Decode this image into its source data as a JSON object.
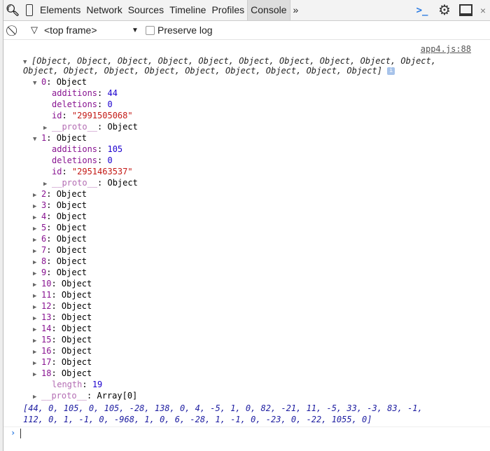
{
  "tabs": [
    "Elements",
    "Network",
    "Sources",
    "Timeline",
    "Profiles",
    "Console"
  ],
  "more": "»",
  "toolbar": {
    "frame": "<top frame>",
    "preserve_log": "Preserve log",
    "preserve_checked": false
  },
  "console": {
    "source_link": "app4.js:88",
    "summary_line1": "[Object, Object, Object, Object, Object, Object, Object, Object, Object, Object,",
    "summary_line2": "Object, Object, Object, Object, Object, Object, Object, Object, Object]",
    "expanded": [
      {
        "index": "0",
        "type": "Object",
        "additions": "44",
        "deletions": "0",
        "id": "\"2991505068\""
      },
      {
        "index": "1",
        "type": "Object",
        "additions": "105",
        "deletions": "0",
        "id": "\"2951463537\""
      }
    ],
    "labels": {
      "additions": "additions",
      "deletions": "deletions",
      "id": "id",
      "proto": "__proto__",
      "object": "Object",
      "length": "length",
      "array_proto": "Array[0]"
    },
    "collapsed": [
      "2",
      "3",
      "4",
      "5",
      "6",
      "7",
      "8",
      "9",
      "10",
      "11",
      "12",
      "13",
      "14",
      "15",
      "16",
      "17",
      "18"
    ],
    "length": "19",
    "array_line1": "[44, 0, 105, 0, 105, -28, 138, 0, 4, -5, 1, 0, 82, -21, 11, -5, 33, -3, 83, -1,",
    "array_line2": "112, 0, 1, -1, 0, -968, 1, 0, 6, -28, 1, -1, 0, -23, 0, -22, 1055, 0]"
  }
}
